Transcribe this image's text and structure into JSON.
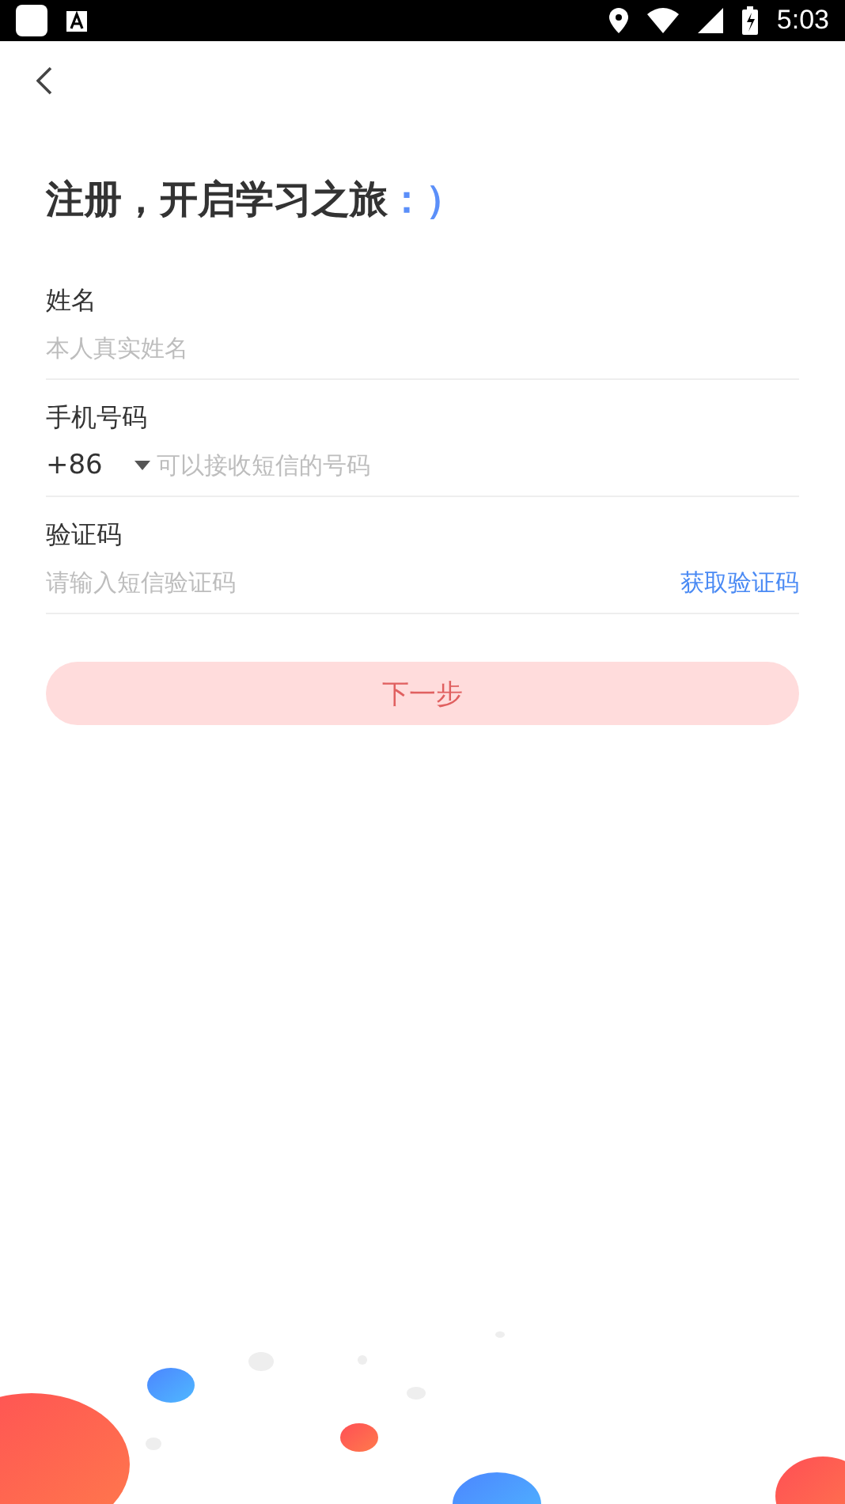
{
  "status_bar": {
    "time": "5:03"
  },
  "title": {
    "text": "注册，开启学习之旅",
    "emoticon": "：）"
  },
  "fields": [
    {
      "kind": "text",
      "label": "姓名",
      "placeholder": "本人真实姓名"
    },
    {
      "kind": "phone",
      "label": "手机号码",
      "country_code": "+86",
      "placeholder": "可以接收短信的号码"
    },
    {
      "kind": "code",
      "label": "验证码",
      "placeholder": "请输入短信验证码",
      "action": "获取验证码"
    }
  ],
  "next_button": {
    "label": "下一步",
    "disabled": true
  }
}
